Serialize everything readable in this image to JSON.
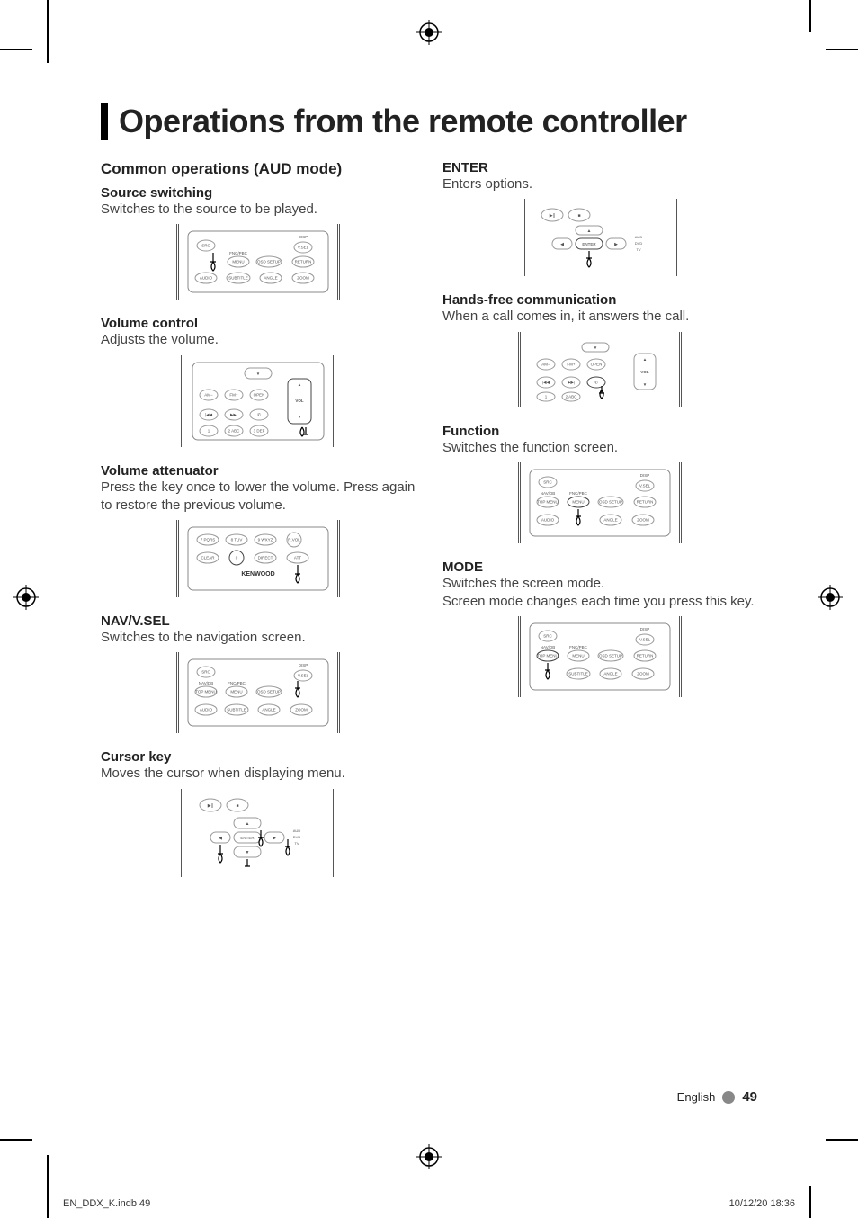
{
  "title": "Operations from the remote controller",
  "left": {
    "subhead": "Common operations (AUD mode)",
    "items": [
      {
        "title": "Source switching",
        "desc": "Switches to the source to be played."
      },
      {
        "title": "Volume control",
        "desc": "Adjusts the volume."
      },
      {
        "title": "Volume attenuator",
        "desc": "Press the key once to lower the volume. Press again to restore the previous volume."
      },
      {
        "title": "NAV/V.SEL",
        "desc": "Switches to the navigation screen."
      },
      {
        "title": "Cursor key",
        "desc": "Moves the cursor when displaying menu."
      }
    ]
  },
  "right": {
    "items": [
      {
        "title": "ENTER",
        "desc": "Enters options."
      },
      {
        "title": "Hands-free communication",
        "desc": "When a call comes in, it answers the call."
      },
      {
        "title": "Function",
        "desc": "Switches the function screen."
      },
      {
        "title": "MODE",
        "desc": "Switches the screen mode.\nScreen mode changes each time you press this key."
      }
    ]
  },
  "remote_labels": {
    "fig1": [
      "SRC",
      "DISP",
      "V.SEL",
      "FNC/PBC",
      "MENU",
      "OSD SETUP",
      "RETURN",
      "AUDIO",
      "SUBTITLE",
      "ANGLE",
      "ZOOM"
    ],
    "fig2": [
      "AM−",
      "FM+",
      "OPEN",
      "VOL",
      "1",
      "2 ABC",
      "3 DEF"
    ],
    "fig3": [
      "7 PQRS",
      "8 TUV",
      "9 WXYZ",
      "R.VOL",
      "CLEAR",
      "0",
      "DIRECT",
      "ATT",
      "KENWOOD"
    ],
    "fig4": [
      "SRC",
      "DISP",
      "V.SEL",
      "NAV/DB",
      "FNC/PBC",
      "TOP MENU",
      "MENU",
      "OSD SETUP",
      "AUDIO",
      "SUBTITLE",
      "ANGLE",
      "ZOOM"
    ],
    "fig5": [
      "ENTER",
      "AUD",
      "DVD",
      "TV"
    ],
    "fig6": [
      "ENTER",
      "AUD",
      "DVD",
      "TV"
    ],
    "fig7": [
      "AM−",
      "FM+",
      "OPEN",
      "VOL",
      "1",
      "2 ABC"
    ],
    "fig8": [
      "SRC",
      "DISP",
      "V.SEL",
      "NAV/DB",
      "FNC/PBC",
      "TOP MENU",
      "MENU",
      "OSD SETUP",
      "RETURN",
      "AUDIO",
      "ANGLE",
      "ZOOM"
    ],
    "fig9": [
      "SRC",
      "DISP",
      "V.SEL",
      "NAV/DB",
      "FNC/PBC",
      "TOP MENU",
      "MENU",
      "OSD SETUP",
      "RETURN",
      "SUBTITLE",
      "ANGLE",
      "ZOOM"
    ]
  },
  "footer": {
    "lang": "English",
    "page": "49"
  },
  "printline": {
    "file": "EN_DDX_K.indb   49",
    "timestamp": "10/12/20   18:36"
  }
}
